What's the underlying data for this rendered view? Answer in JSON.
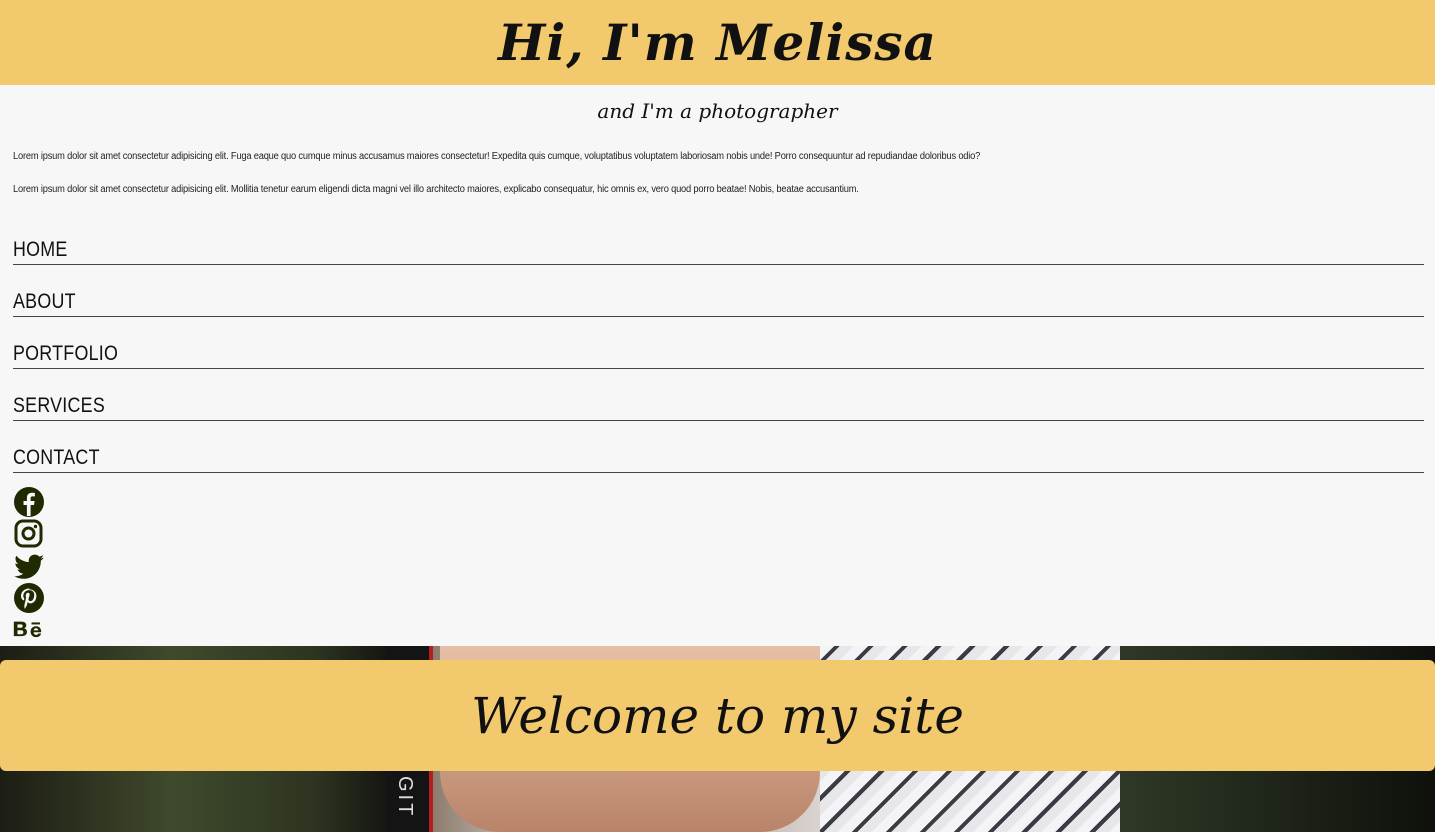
{
  "header": {
    "title": "Hi, I'm Melissa",
    "subtitle": "and I'm a photographer"
  },
  "intro": {
    "paragraphs": [
      "Lorem ipsum dolor sit amet consectetur adipisicing elit. Fuga eaque quo cumque minus accusamus maiores consectetur! Expedita quis cumque, voluptatibus voluptatem laboriosam nobis unde! Porro consequuntur ad repudiandae doloribus odio?",
      "Lorem ipsum dolor sit amet consectetur adipisicing elit. Mollitia tenetur earum eligendi dicta magni vel illo architecto maiores, explicabo consequatur, hic omnis ex, vero quod porro beatae! Nobis, beatae accusantium."
    ]
  },
  "nav": {
    "items": [
      "HOME",
      "ABOUT",
      "PORTFOLIO",
      "SERVICES",
      "CONTACT"
    ]
  },
  "social": {
    "icons": [
      "facebook-icon",
      "instagram-icon",
      "twitter-icon",
      "pinterest-icon",
      "behance-icon"
    ]
  },
  "hero": {
    "welcome": "Welcome to my site",
    "strap_text": "GIT"
  },
  "colors": {
    "accent": "#f2ca6d",
    "background": "#f7f7f7",
    "icon": "#1f2a00"
  }
}
